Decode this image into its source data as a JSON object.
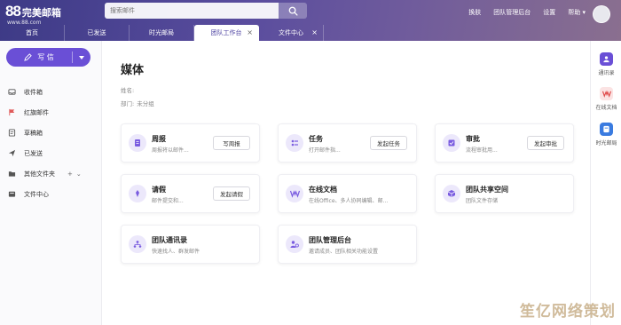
{
  "logo": {
    "brand": "88",
    "name": "完美邮箱",
    "url": "www.88.com"
  },
  "search": {
    "placeholder": "搜索邮件"
  },
  "header": {
    "links": [
      "换肤",
      "团队管理后台",
      "设置",
      "帮助"
    ]
  },
  "tabs": [
    {
      "label": "首页",
      "active": false,
      "closable": false
    },
    {
      "label": "已发送",
      "active": false,
      "closable": false
    },
    {
      "label": "时光邮局",
      "active": false,
      "closable": false
    },
    {
      "label": "团队工作台",
      "active": true,
      "closable": true
    },
    {
      "label": "文件中心",
      "active": false,
      "closable": true
    }
  ],
  "sidebar": {
    "write_label": "写 信",
    "items": [
      {
        "label": "收件箱",
        "icon": "inbox-icon"
      },
      {
        "label": "红旗邮件",
        "icon": "flag-icon"
      },
      {
        "label": "草稿箱",
        "icon": "draft-icon"
      },
      {
        "label": "已发送",
        "icon": "send-icon"
      },
      {
        "label": "其他文件夹",
        "icon": "folder-icon"
      },
      {
        "label": "文件中心",
        "icon": "file-icon"
      }
    ]
  },
  "main": {
    "title": "媒体",
    "name_label": "姓名:",
    "dept_label": "部门:",
    "dept_value": "未分组",
    "cards": [
      {
        "title": "周报",
        "desc": "周报将以邮件...",
        "button": "写周报",
        "icon": "report-icon"
      },
      {
        "title": "任务",
        "desc": "打开邮件指...",
        "button": "发起任务",
        "icon": "task-icon"
      },
      {
        "title": "审批",
        "desc": "流程审批用...",
        "button": "发起审批",
        "icon": "approval-icon"
      },
      {
        "title": "请假",
        "desc": "邮件提交和...",
        "button": "发起请假",
        "icon": "leave-icon"
      },
      {
        "title": "在线文档",
        "desc": "在线Office、多人协同编辑、邮...",
        "button": "",
        "icon": "doc-icon"
      },
      {
        "title": "团队共享空间",
        "desc": "团队文件存储",
        "button": "",
        "icon": "cloud-icon"
      },
      {
        "title": "团队通讯录",
        "desc": "快速找人、群发邮件",
        "button": "",
        "icon": "contacts-icon"
      },
      {
        "title": "团队管理后台",
        "desc": "邀请成员、团队相关功能设置",
        "button": "",
        "icon": "admin-icon"
      }
    ]
  },
  "rightbar": {
    "items": [
      {
        "label": "通讯录",
        "color": "#6a4fd6"
      },
      {
        "label": "在线文档",
        "color": "#e04a4a"
      },
      {
        "label": "时光邮局",
        "color": "#3a7be0"
      }
    ]
  },
  "watermark": "笙亿网络策划",
  "colors": {
    "accent": "#6a4fd6",
    "header": "#4b4396"
  }
}
